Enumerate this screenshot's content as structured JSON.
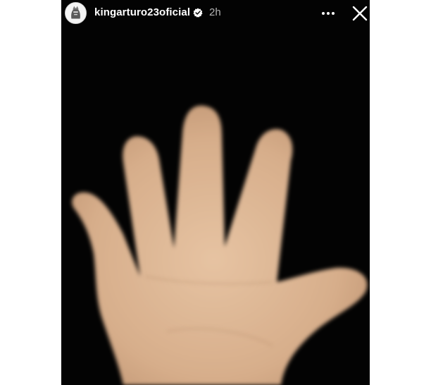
{
  "story": {
    "username": "kingarturo23oficial",
    "timestamp": "2h",
    "verified": true
  },
  "icons": {
    "avatar": "profile-picture",
    "verified": "verified-badge-icon",
    "more": "more-options-icon",
    "close": "close-icon"
  },
  "colors": {
    "background": "#030303",
    "skin": "#d8b08e",
    "text": "#ffffff",
    "muted_text": "#b4b4b4"
  }
}
